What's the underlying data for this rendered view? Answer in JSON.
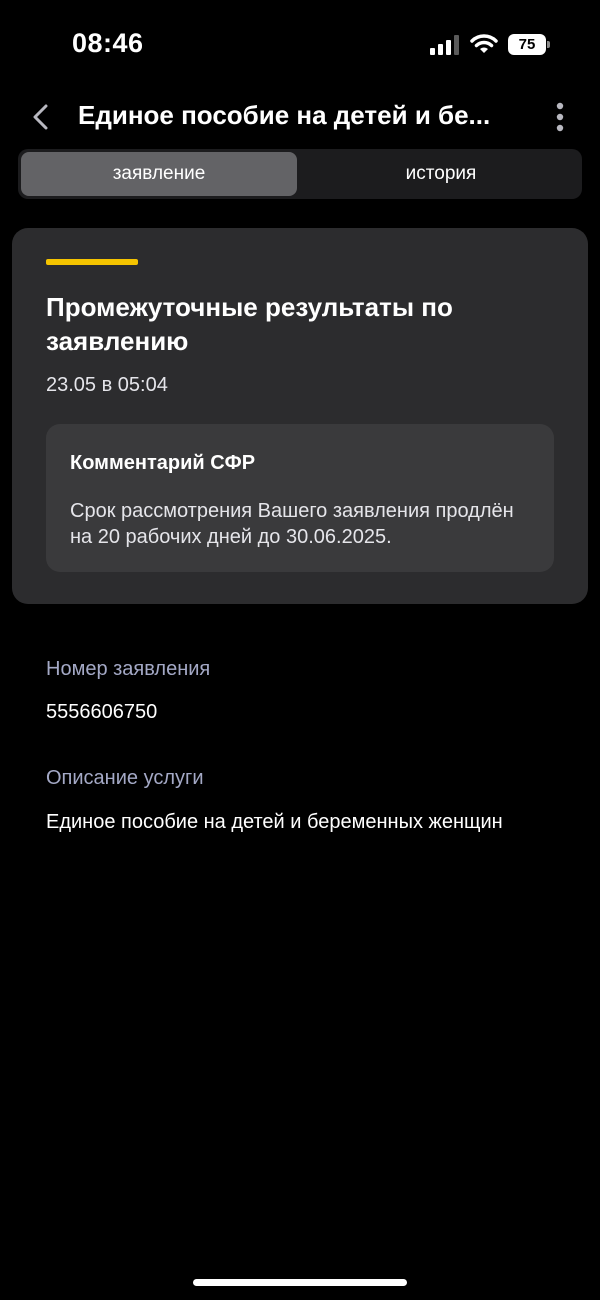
{
  "status_bar": {
    "time": "08:46",
    "battery_level": "75",
    "signal_icon": "cellular-signal-icon",
    "wifi_icon": "wifi-icon"
  },
  "nav": {
    "title": "Единое пособие на детей и бе...",
    "back_icon": "chevron-left-icon",
    "more_icon": "vertical-dots-icon"
  },
  "tabs": [
    {
      "label": "заявление",
      "active": true
    },
    {
      "label": "история",
      "active": false
    }
  ],
  "card": {
    "accent_color": "#f5c400",
    "title": "Промежуточные результаты по заявлению",
    "date": "23.05 в 05:04",
    "comment": {
      "title": "Комментарий СФР",
      "text": "Срок рассмотрения Вашего заявления продлён на 20 рабочих дней до 30.06.2025."
    }
  },
  "details": {
    "number_label": "Номер заявления",
    "number_value": "5556606750",
    "description_label": "Описание услуги",
    "description_value": "Единое пособие на детей и беременных женщин"
  }
}
